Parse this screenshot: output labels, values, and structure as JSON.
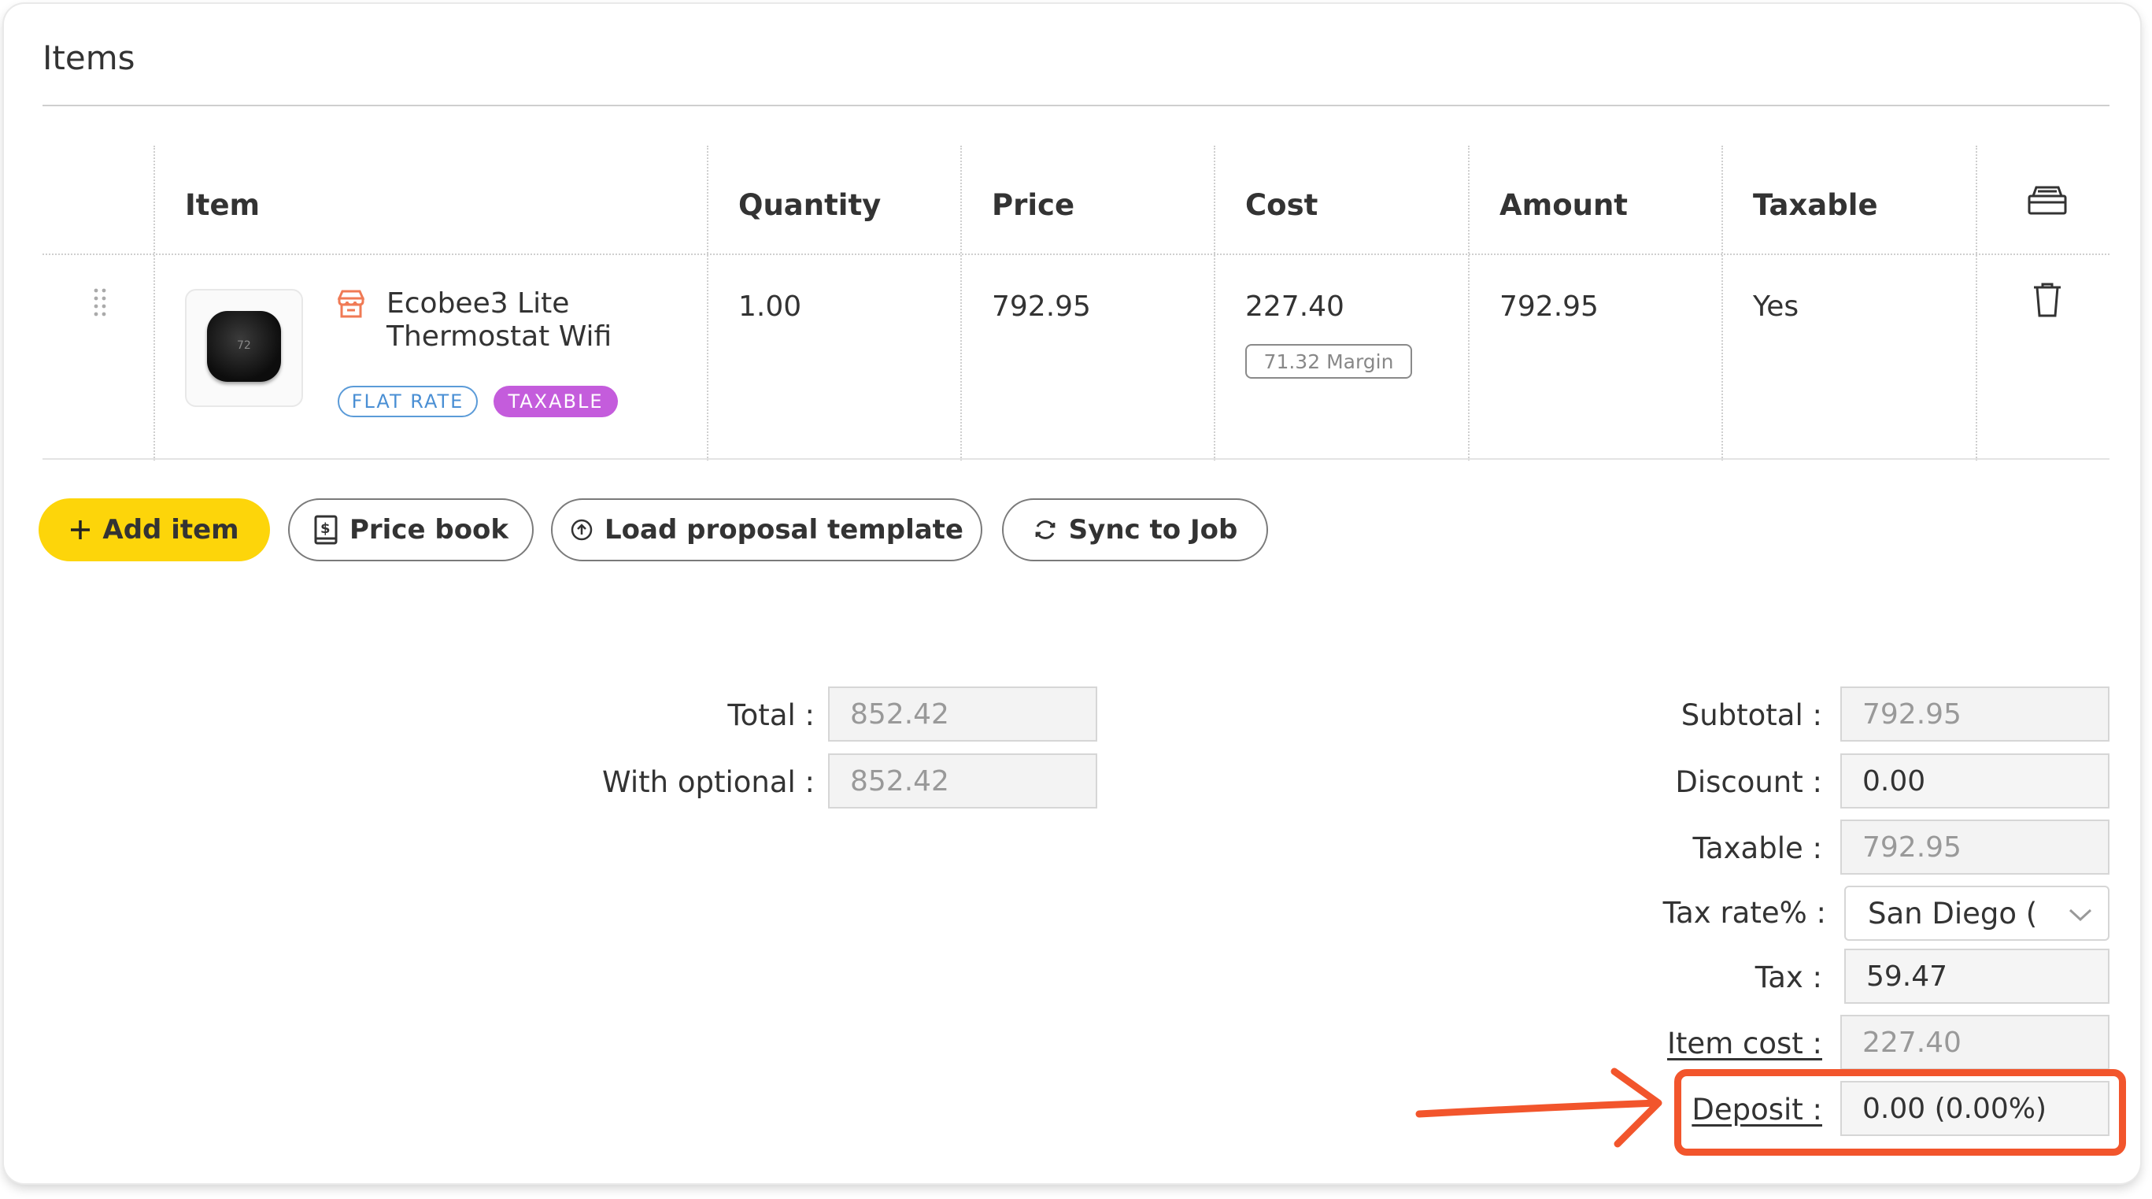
{
  "section": {
    "title": "Items"
  },
  "table": {
    "headers": {
      "item": "Item",
      "quantity": "Quantity",
      "price": "Price",
      "cost": "Cost",
      "amount": "Amount",
      "taxable": "Taxable"
    },
    "rows": [
      {
        "name_line1": "Ecobee3 Lite",
        "name_line2": "Thermostat Wifi",
        "thumb_text": "72",
        "tag_flat": "FLAT RATE",
        "tag_taxable": "TAXABLE",
        "quantity": "1.00",
        "price": "792.95",
        "cost": "227.40",
        "margin": "71.32 Margin",
        "amount": "792.95",
        "taxable": "Yes"
      }
    ]
  },
  "actions": {
    "add_item": "Add item",
    "price_book": "Price book",
    "load_template": "Load proposal template",
    "sync_job": "Sync to Job"
  },
  "totals_left": {
    "total_label": "Total :",
    "total_value": "852.42",
    "optional_label": "With optional :",
    "optional_value": "852.42"
  },
  "totals_right": {
    "subtotal_label": "Subtotal :",
    "subtotal_value": "792.95",
    "discount_label": "Discount :",
    "discount_value": "0.00",
    "taxable_label": "Taxable :",
    "taxable_value": "792.95",
    "tax_rate_label": "Tax rate% :",
    "tax_rate_value": "San Diego (",
    "tax_label": "Tax :",
    "tax_value": "59.47",
    "item_cost_label": "Item cost :",
    "item_cost_value": "227.40",
    "deposit_label": "Deposit :",
    "deposit_value": "0.00 (0.00%)"
  },
  "colors": {
    "accent_yellow": "#fdd50a",
    "highlight_orange": "#f2552c",
    "tag_flat_blue": "#4a8fd4",
    "tag_taxable_purple": "#c45cdc"
  },
  "icons": [
    "drag-handle-icon",
    "store-icon",
    "archive-icon",
    "trash-icon",
    "plus-icon",
    "price-book-icon",
    "upload-circle-icon",
    "sync-icon",
    "chevron-down-icon",
    "arrow-annotation"
  ]
}
